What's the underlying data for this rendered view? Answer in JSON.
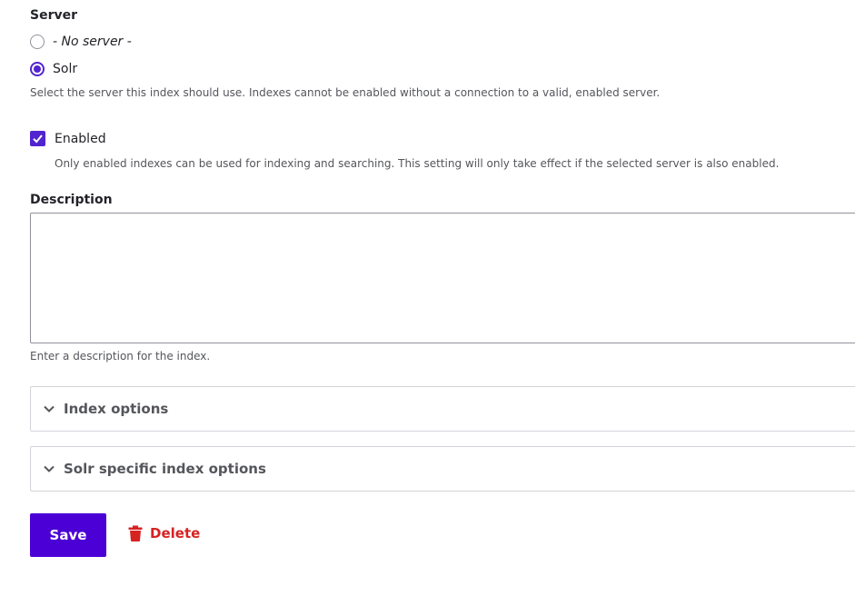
{
  "server": {
    "label": "Server",
    "options": [
      {
        "label": "- No server -",
        "checked": false
      },
      {
        "label": "Solr",
        "checked": true
      }
    ],
    "description": "Select the server this index should use. Indexes cannot be enabled without a connection to a valid, enabled server."
  },
  "enabled": {
    "label": "Enabled",
    "checked": true,
    "description": "Only enabled indexes can be used for indexing and searching. This setting will only take effect if the selected server is also enabled."
  },
  "description_field": {
    "label": "Description",
    "value": "",
    "help": "Enter a description for the index."
  },
  "sections": [
    {
      "title": "Index options",
      "icon": "chevron-down-icon"
    },
    {
      "title": "Solr specific index options",
      "icon": "chevron-down-icon"
    }
  ],
  "actions": {
    "save_label": "Save",
    "delete_label": "Delete",
    "delete_icon": "trash-icon"
  },
  "colors": {
    "accent": "#5124d0",
    "primary_button": "#4b00d6",
    "danger": "#d72222"
  }
}
